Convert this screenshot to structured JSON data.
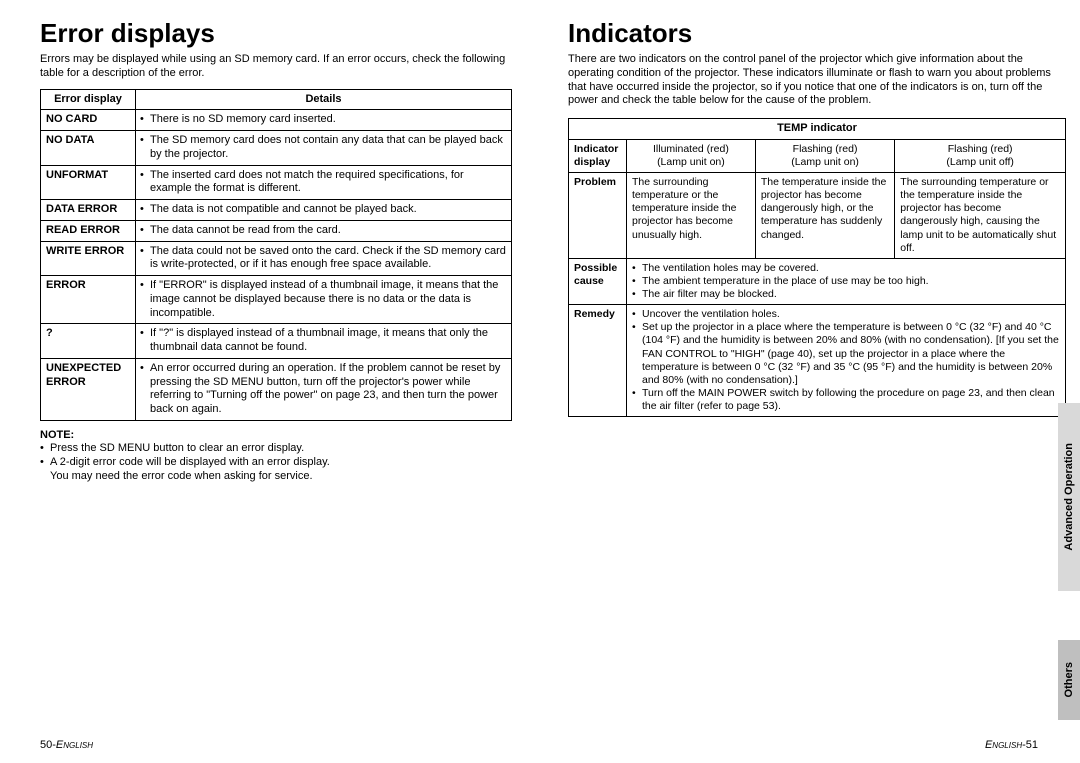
{
  "left": {
    "title": "Error displays",
    "intro": "Errors may be displayed while using an SD memory card. If an error occurs, check the following table for a description of the error.",
    "headers": {
      "c1": "Error display",
      "c2": "Details"
    },
    "rows": [
      {
        "name": "NO CARD",
        "detail": "There is no SD memory card inserted."
      },
      {
        "name": "NO DATA",
        "detail": "The SD memory card does not contain any data that can be played back by the projector."
      },
      {
        "name": "UNFORMAT",
        "detail": "The inserted card does not match the required specifications, for example the format is different."
      },
      {
        "name": "DATA ERROR",
        "detail": "The data is not compatible and cannot be played back."
      },
      {
        "name": "READ ERROR",
        "detail": "The data cannot be read from the card."
      },
      {
        "name": "WRITE ERROR",
        "detail": "The data could not be saved onto the card. Check if the SD memory card is write-protected, or if it has enough free space available."
      },
      {
        "name": "ERROR",
        "detail": "If \"ERROR\" is displayed instead of a thumbnail image, it means that the image cannot be displayed because there is no data or the data is incompatible."
      },
      {
        "name": "?",
        "detail": "If \"?\" is displayed instead of a thumbnail image, it means that only the thumbnail data cannot be found."
      },
      {
        "name": "UNEXPECTED ERROR",
        "detail": "An error occurred during an operation. If the problem cannot be reset by pressing the SD MENU button, turn off the projector's power while referring to \"Turning off the power\" on page 23, and then turn the power back on again."
      }
    ],
    "note_head": "NOTE:",
    "notes": [
      "Press the SD MENU button to clear an error display.",
      "A 2-digit error code will be displayed with an error display.",
      "You may need the error code when asking for service."
    ],
    "footer_num": "50-",
    "footer_lang": "English"
  },
  "right": {
    "title": "Indicators",
    "intro": "There are two indicators on the control panel of the projector which give information about the operating condition of the projector. These indicators illuminate or flash to warn you about problems that have occurred inside the projector, so if you notice that one of the indicators is on, turn off the power and check the table below for the cause of the problem.",
    "header": "TEMP indicator",
    "row_indicator": "Indicator display",
    "indicator_cols": [
      {
        "a": "Illuminated (red)",
        "b": "(Lamp unit on)"
      },
      {
        "a": "Flashing (red)",
        "b": "(Lamp unit on)"
      },
      {
        "a": "Flashing (red)",
        "b": "(Lamp unit off)"
      }
    ],
    "row_problem": "Problem",
    "problems": [
      "The surrounding temperature or the temperature inside the projector has become unusually high.",
      "The temperature inside the projector has become dangerously high, or the temperature has suddenly changed.",
      "The surrounding temperature or the temperature inside the projector has become dangerously high, causing the lamp unit to be automatically shut off."
    ],
    "row_cause": "Possible cause",
    "causes": [
      "The ventilation holes may be covered.",
      "The ambient temperature in the place of use may be too high.",
      "The air filter may be blocked."
    ],
    "row_remedy": "Remedy",
    "remedies": [
      "Uncover the ventilation holes.",
      "Set up the projector in a place where the temperature is between 0 °C (32 °F) and 40 °C (104 °F) and the humidity is between 20% and 80% (with no condensation). [If you set the FAN CONTROL to \"HIGH\" (page 40), set up the projector in a place where the temperature is between 0 °C (32 °F) and 35 °C (95 °F) and the humidity is between 20% and 80% (with no condensation).]",
      "Turn off the MAIN POWER switch by following the procedure on page 23, and then clean the air filter (refer to page 53)."
    ],
    "footer_lang": "English",
    "footer_num": "-51",
    "tab_adv": "Advanced Operation",
    "tab_others": "Others"
  }
}
